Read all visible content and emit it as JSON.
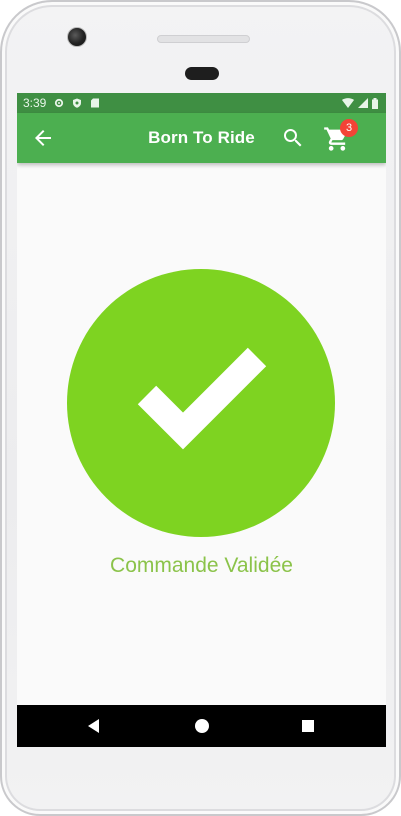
{
  "status_bar": {
    "time": "3:39",
    "icons_left": [
      "settings-icon",
      "shield-icon",
      "sd-card-icon"
    ],
    "icons_right": [
      "wifi-icon",
      "signal-icon",
      "battery-icon"
    ]
  },
  "app_bar": {
    "title": "Born To Ride",
    "back_icon": "arrow-back-icon",
    "search_icon": "search-icon",
    "cart_icon": "shopping-cart-icon",
    "cart_count": "3"
  },
  "content": {
    "success_icon": "check-icon",
    "message": "Commande Validée"
  },
  "nav_bar": {
    "buttons": [
      "back-triangle-icon",
      "home-circle-icon",
      "recents-square-icon"
    ]
  },
  "colors": {
    "app_bar": "#4caf50",
    "status_bar": "#3f8f43",
    "success": "#7ed321",
    "message_text": "#8bc34a",
    "badge": "#f44336"
  }
}
